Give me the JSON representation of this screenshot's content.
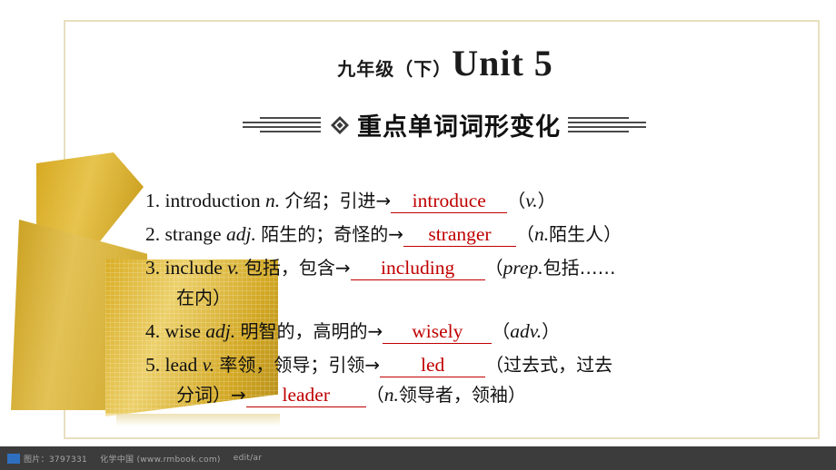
{
  "slide": {
    "title_cn": "九年级（下）",
    "title_en": "Unit 5",
    "banner_text": "重点单词词形变化",
    "banner_icon": "diamond-icon"
  },
  "items": [
    {
      "num": "1.",
      "word": "introduction",
      "pos": "n.",
      "meaning": "介绍；引进→",
      "answer": "introduce",
      "tail_open": "（",
      "tail_pos": "v.",
      "tail_close": "）"
    },
    {
      "num": "2.",
      "word": "strange",
      "pos": "adj.",
      "meaning": "陌生的；奇怪的→",
      "answer": "stranger",
      "tail_open": "（",
      "tail_pos": "n.",
      "tail_close": "陌生人）"
    },
    {
      "num": "3.",
      "word": "include",
      "pos": "v.",
      "meaning": "包括，包含→",
      "answer": "including",
      "tail_open": "（",
      "tail_pos": "prep.",
      "tail_close": "包括……",
      "tail_line2": "在内）"
    },
    {
      "num": "4.",
      "word": "wise",
      "pos": "adj.",
      "meaning": "明智的，高明的→",
      "answer": "wisely",
      "tail_open": "（",
      "tail_pos": "adv.",
      "tail_close": "）"
    },
    {
      "num": "5.",
      "word": "lead",
      "pos": "v.",
      "meaning": "率领，领导；引领→",
      "answer": "led",
      "tail_open": "（",
      "tail_close": "过去式，过去",
      "tail_line2": "分词）→",
      "answer2": "leader",
      "tail2_open": "（",
      "tail2_pos": "n.",
      "tail2_close": "领导者，领袖）"
    }
  ],
  "footer": {
    "id_text": "图片：3797331",
    "site_text": "化学中国 (www.rmbook.com)",
    "extra_text": "edit/ar"
  },
  "colors": {
    "answer": "#c00000",
    "frame": "#e8dfc0",
    "ribbon_gold": "#d9ad24",
    "footer_bg": "#3c3c3c"
  }
}
